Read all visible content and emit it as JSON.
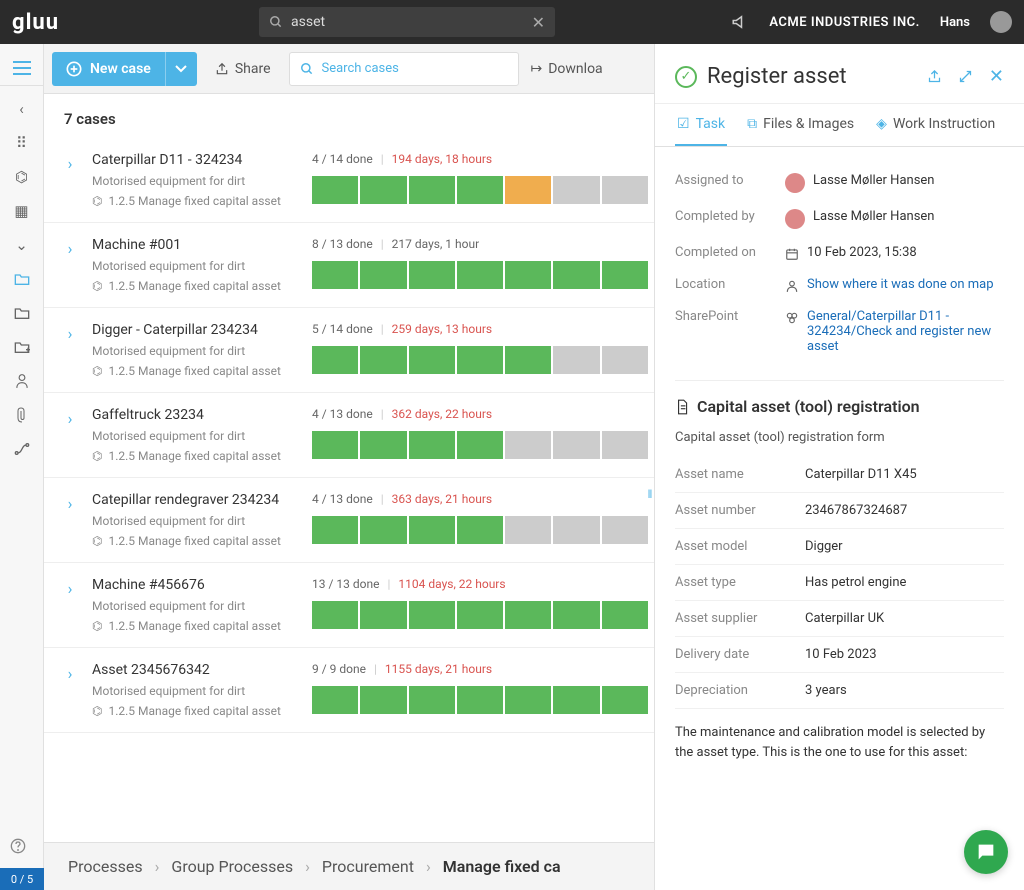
{
  "topbar": {
    "logo": "gluu",
    "search_value": "asset",
    "company": "ACME INDUSTRIES INC.",
    "username": "Hans"
  },
  "toolbar": {
    "new_case": "New case",
    "share": "Share",
    "search_placeholder": "Search cases",
    "download": "Downloa"
  },
  "leftrail": {
    "counter": "0 / 5"
  },
  "case_count": "7 cases",
  "cases": [
    {
      "title": "Caterpillar D11 - 324234",
      "sub1": "Motorised equipment for dirt",
      "sub2": "1.2.5 Manage fixed capital asset",
      "done": "4 / 14 done",
      "time": "194 days, 18 hours",
      "late": true,
      "segs": [
        "g",
        "g",
        "g",
        "g",
        "o",
        "gr",
        "gr"
      ]
    },
    {
      "title": "Machine #001",
      "sub1": "Motorised equipment for dirt",
      "sub2": "1.2.5 Manage fixed capital asset",
      "done": "8 / 13 done",
      "time": "217 days, 1 hour",
      "late": false,
      "segs": [
        "g",
        "g",
        "g",
        "g",
        "g",
        "g",
        "g"
      ]
    },
    {
      "title": "Digger - Caterpillar 234234",
      "sub1": "Motorised equipment for dirt",
      "sub2": "1.2.5 Manage fixed capital asset",
      "done": "5 / 14 done",
      "time": "259 days, 13 hours",
      "late": true,
      "segs": [
        "g",
        "g",
        "g",
        "g",
        "g",
        "gr",
        "gr"
      ]
    },
    {
      "title": "Gaffeltruck 23234",
      "sub1": "Motorised equipment for dirt",
      "sub2": "1.2.5 Manage fixed capital asset",
      "done": "4 / 13 done",
      "time": "362 days, 22 hours",
      "late": true,
      "segs": [
        "g",
        "g",
        "g",
        "g",
        "gr",
        "gr",
        "gr"
      ]
    },
    {
      "title": "Catepillar rendegraver 234234",
      "sub1": "Motorised equipment for dirt",
      "sub2": "1.2.5 Manage fixed capital asset",
      "done": "4 / 13 done",
      "time": "363 days, 21 hours",
      "late": true,
      "segs": [
        "g",
        "g",
        "g",
        "g",
        "gr",
        "gr",
        "gr"
      ]
    },
    {
      "title": "Machine #456676",
      "sub1": "Motorised equipment for dirt",
      "sub2": "1.2.5 Manage fixed capital asset",
      "done": "13 / 13 done",
      "time": "1104 days, 22 hours",
      "late": true,
      "segs": [
        "g",
        "g",
        "g",
        "g",
        "g",
        "g",
        "g"
      ]
    },
    {
      "title": "Asset 2345676342",
      "sub1": "Motorised equipment for dirt",
      "sub2": "1.2.5 Manage fixed capital asset",
      "done": "9 / 9 done",
      "time": "1155 days, 21 hours",
      "late": true,
      "segs": [
        "g",
        "g",
        "g",
        "g",
        "g",
        "g",
        "g"
      ]
    }
  ],
  "breadcrumb": [
    "Processes",
    "Group Processes",
    "Procurement",
    "Manage fixed ca"
  ],
  "detail": {
    "title": "Register asset",
    "tabs": {
      "task": "Task",
      "files": "Files & Images",
      "wi": "Work Instruction"
    },
    "meta": {
      "assigned_label": "Assigned to",
      "assigned_value": "Lasse Møller Hansen",
      "completedby_label": "Completed by",
      "completedby_value": "Lasse Møller Hansen",
      "completedon_label": "Completed on",
      "completedon_value": "10 Feb 2023, 15:38",
      "location_label": "Location",
      "location_value": "Show where it was done on map",
      "sharepoint_label": "SharePoint",
      "sharepoint_value": "General/Caterpillar D11 - 324234/Check and register new asset"
    },
    "form": {
      "heading": "Capital asset (tool) registration",
      "subtitle": "Capital asset (tool) registration form",
      "rows": [
        {
          "label": "Asset name",
          "value": "Caterpillar D11 X45"
        },
        {
          "label": "Asset number",
          "value": "23467867324687"
        },
        {
          "label": "Asset model",
          "value": "Digger"
        },
        {
          "label": "Asset type",
          "value": "Has petrol engine"
        },
        {
          "label": "Asset supplier",
          "value": "Caterpillar UK"
        },
        {
          "label": "Delivery date",
          "value": "10 Feb 2023"
        },
        {
          "label": "Depreciation",
          "value": "3 years"
        }
      ],
      "note": "The maintenance and calibration model is selected by the asset type. This is the one to use for this asset:"
    }
  }
}
